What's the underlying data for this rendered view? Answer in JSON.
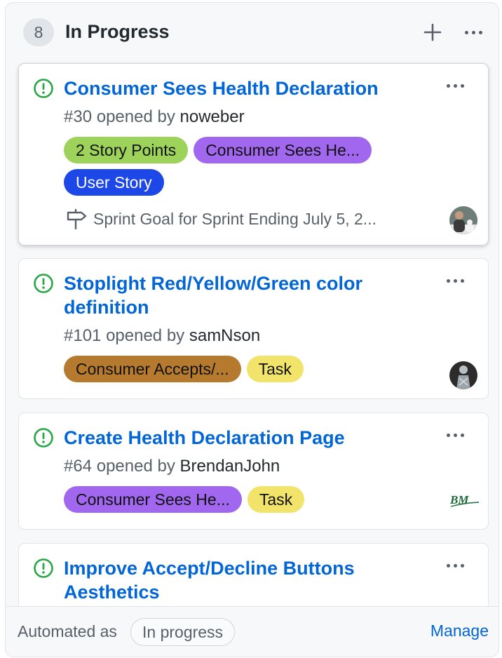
{
  "column": {
    "count": "8",
    "title": "In Progress"
  },
  "cards": [
    {
      "title": "Consumer Sees Health Declaration",
      "number": "#30",
      "opened_by": "opened by",
      "author": "noweber",
      "labels": [
        {
          "text": "2 Story Points",
          "bg": "#9dd25b",
          "fg": "#111111"
        },
        {
          "text": "Consumer Sees He...",
          "bg": "#a167ef",
          "fg": "#111111"
        },
        {
          "text": "User Story",
          "bg": "#1d47e6",
          "fg": "#ffffff"
        }
      ],
      "milestone": "Sprint Goal for Sprint Ending July 5, 2..."
    },
    {
      "title": "Stoplight Red/Yellow/Green color definition",
      "number": "#101",
      "opened_by": "opened by",
      "author": "samNson",
      "labels": [
        {
          "text": "Consumer Accepts/...",
          "bg": "#b57a2e",
          "fg": "#111111"
        },
        {
          "text": "Task",
          "bg": "#f2e46a",
          "fg": "#111111"
        }
      ]
    },
    {
      "title": "Create Health Declaration Page",
      "number": "#64",
      "opened_by": "opened by",
      "author": "BrendanJohn",
      "labels": [
        {
          "text": "Consumer Sees He...",
          "bg": "#a167ef",
          "fg": "#111111"
        },
        {
          "text": "Task",
          "bg": "#f2e46a",
          "fg": "#111111"
        }
      ],
      "avatar_text": "BM"
    },
    {
      "title": "Improve Accept/Decline Buttons Aesthetics"
    }
  ],
  "footer": {
    "automated_label": "Automated as",
    "automated_value": "In progress",
    "manage": "Manage"
  },
  "colors": {
    "link": "#0366d6",
    "open_issue": "#28a745"
  },
  "icons": [
    "issue-opened-icon",
    "plus-icon",
    "kebab-horizontal-icon",
    "milestone-icon"
  ]
}
